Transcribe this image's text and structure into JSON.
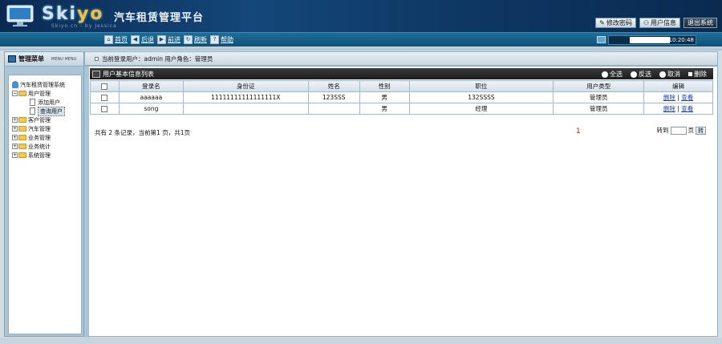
{
  "brand": {
    "logo_text_a": "Sk",
    "logo_text_b": "i",
    "logo_text_c": "y",
    "logo_text_d": "o",
    "sub": "Skiyo.cn - by Jessica",
    "app_title": "汽车租赁管理平台"
  },
  "header_buttons": {
    "change_password": "修改密码",
    "user_info": "用户信息",
    "logout": "退出系统"
  },
  "toolbar": {
    "home": "首页",
    "back": "后退",
    "forward": "前进",
    "refresh": "刷新",
    "help": "帮助",
    "clock": "10:20:48"
  },
  "sidebar": {
    "title": "管理菜单",
    "subtitle": "MENU MENU",
    "tree": {
      "root": "汽车租赁管理系统",
      "user_mgmt": "用户管理",
      "add_user": "添加用户",
      "query_user": "查询用户",
      "customer_mgmt": "客户管理",
      "car_mgmt": "汽车管理",
      "business_mgmt": "业务管理",
      "business_stats": "业务统计",
      "system_mgmt": "系统管理"
    }
  },
  "location": {
    "text": "当前登录用户：admin 用户角色：管理员"
  },
  "table": {
    "title": "用户基本信息列表",
    "actions": {
      "select_all": "全选",
      "invert": "反选",
      "cancel": "取消",
      "delete": "删除"
    },
    "columns": [
      "登录名",
      "身份证",
      "姓名",
      "性别",
      "职位",
      "用户类型",
      "编辑"
    ],
    "rows": [
      {
        "login": "aaaaaa",
        "id_card": "11111111111111111X",
        "name": "123SSS",
        "gender": "男",
        "position": "132SSSS",
        "type": "管理员",
        "delete": "删除",
        "view": "查看"
      },
      {
        "login": "song",
        "id_card": "",
        "name": "",
        "gender": "男",
        "position": "经理",
        "type": "管理员",
        "delete": "删除",
        "view": "查看"
      }
    ]
  },
  "pager": {
    "summary": "共有 2 条记录，当前第1 页，共1页",
    "page": "1",
    "goto_label": "转到",
    "page_unit": "页",
    "go": "转"
  }
}
